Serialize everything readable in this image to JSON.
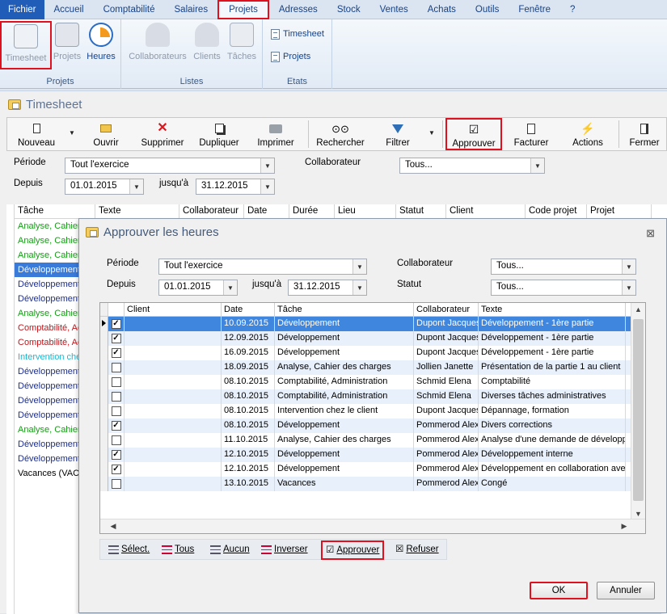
{
  "menu": [
    "Fichier",
    "Accueil",
    "Comptabilité",
    "Salaires",
    "Projets",
    "Adresses",
    "Stock",
    "Ventes",
    "Achats",
    "Outils",
    "Fenêtre",
    "?"
  ],
  "ribbon": {
    "groups": {
      "projets": {
        "label": "Projets",
        "buttons": [
          "Timesheet",
          "Projets",
          "Heures"
        ]
      },
      "listes": {
        "label": "Listes",
        "buttons": [
          "Collaborateurs",
          "Clients",
          "Tâches"
        ]
      },
      "etats": {
        "label": "Etats",
        "items": [
          "Timesheet",
          "Projets"
        ]
      }
    }
  },
  "timesheet": {
    "title": "Timesheet",
    "toolbar": {
      "nouveau": "Nouveau",
      "ouvrir": "Ouvrir",
      "supprimer": "Supprimer",
      "dupliquer": "Dupliquer",
      "imprimer": "Imprimer",
      "rechercher": "Rechercher",
      "filtrer": "Filtrer",
      "approuver": "Approuver",
      "facturer": "Facturer",
      "actions": "Actions",
      "fermer": "Fermer"
    },
    "filters": {
      "periode_label": "Période",
      "periode_value": "Tout l'exercice",
      "depuis_label": "Depuis",
      "depuis_value": "01.01.2015",
      "jusqua_label": "jusqu'à",
      "jusqua_value": "31.12.2015",
      "collab_label": "Collaborateur",
      "collab_value": "Tous..."
    },
    "columns": [
      "Tâche",
      "Texte",
      "Collaborateur",
      "Date",
      "Durée",
      "Lieu",
      "Statut",
      "Client",
      "Code projet",
      "Projet"
    ],
    "rows": [
      {
        "text": "Analyse, Cahier",
        "color": "#1a9a1a"
      },
      {
        "text": "Analyse, Cahier",
        "color": "#1a9a1a"
      },
      {
        "text": "Analyse, Cahier",
        "color": "#1a9a1a"
      },
      {
        "text": "Développement",
        "color": "#ffffff"
      },
      {
        "text": "Développement",
        "color": "#1c2f8c"
      },
      {
        "text": "Développement",
        "color": "#1c2f8c"
      },
      {
        "text": "Analyse, Cahier",
        "color": "#1a9a1a"
      },
      {
        "text": "Comptabilité, Ac",
        "color": "#c0161b"
      },
      {
        "text": "Comptabilité, Ac",
        "color": "#c0161b"
      },
      {
        "text": "Intervention che",
        "color": "#1ab8cf"
      },
      {
        "text": "Développement",
        "color": "#1c2f8c"
      },
      {
        "text": "Développement",
        "color": "#1c2f8c"
      },
      {
        "text": "Développement",
        "color": "#1c2f8c"
      },
      {
        "text": "Développement",
        "color": "#1c2f8c"
      },
      {
        "text": "Analyse, Cahier",
        "color": "#1a9a1a"
      },
      {
        "text": "Développement",
        "color": "#1c2f8c"
      },
      {
        "text": "Développement",
        "color": "#1c2f8c"
      },
      {
        "text": "Vacances (VAC",
        "color": "#000000"
      }
    ]
  },
  "dialog": {
    "title": "Approuver les heures",
    "filters": {
      "periode_label": "Période",
      "periode_value": "Tout l'exercice",
      "depuis_label": "Depuis",
      "depuis_value": "01.01.2015",
      "jusqua_label": "jusqu'à",
      "jusqua_value": "31.12.2015",
      "collab_label": "Collaborateur",
      "collab_value": "Tous...",
      "statut_label": "Statut",
      "statut_value": "Tous..."
    },
    "columns": [
      "Client",
      "Date",
      "Tâche",
      "Collaborateur",
      "Texte"
    ],
    "rows": [
      {
        "checked": true,
        "client": "",
        "date": "10.09.2015",
        "tache": "Développement",
        "collab": "Dupont Jacques",
        "texte": "Développement - 1ère partie"
      },
      {
        "checked": true,
        "client": "",
        "date": "12.09.2015",
        "tache": "Développement",
        "collab": "Dupont Jacques",
        "texte": "Développement - 1ère partie"
      },
      {
        "checked": true,
        "client": "",
        "date": "16.09.2015",
        "tache": "Développement",
        "collab": "Dupont Jacques",
        "texte": "Développement - 1ère partie"
      },
      {
        "checked": false,
        "client": "",
        "date": "18.09.2015",
        "tache": "Analyse, Cahier des charges",
        "collab": "Jollien Janette",
        "texte": "Présentation de la partie 1 au client"
      },
      {
        "checked": false,
        "client": "",
        "date": "08.10.2015",
        "tache": "Comptabilité, Administration",
        "collab": "Schmid Elena",
        "texte": "Comptabilité"
      },
      {
        "checked": false,
        "client": "",
        "date": "08.10.2015",
        "tache": "Comptabilité, Administration",
        "collab": "Schmid Elena",
        "texte": "Diverses tâches administratives"
      },
      {
        "checked": false,
        "client": "",
        "date": "08.10.2015",
        "tache": "Intervention chez le client",
        "collab": "Dupont Jacques",
        "texte": "Dépannage, formation"
      },
      {
        "checked": true,
        "client": "",
        "date": "08.10.2015",
        "tache": "Développement",
        "collab": "Pommerod Alexa",
        "texte": "Divers corrections"
      },
      {
        "checked": false,
        "client": "",
        "date": "11.10.2015",
        "tache": "Analyse, Cahier des charges",
        "collab": "Pommerod Alexa",
        "texte": "Analyse d'une demande de développe"
      },
      {
        "checked": true,
        "client": "",
        "date": "12.10.2015",
        "tache": "Développement",
        "collab": "Pommerod Alexa",
        "texte": "Développement interne"
      },
      {
        "checked": true,
        "client": "",
        "date": "12.10.2015",
        "tache": "Développement",
        "collab": "Pommerod Alexa",
        "texte": "Développement en collaboration avec"
      },
      {
        "checked": false,
        "client": "",
        "date": "13.10.2015",
        "tache": "Vacances",
        "collab": "Pommerod Alexa",
        "texte": "Congé"
      }
    ],
    "actions": {
      "select": "Sélect.",
      "tous": "Tous",
      "aucun": "Aucun",
      "inverser": "Inverser",
      "approuver": "Approuver",
      "refuser": "Refuser"
    },
    "ok": "OK",
    "annuler": "Annuler"
  }
}
